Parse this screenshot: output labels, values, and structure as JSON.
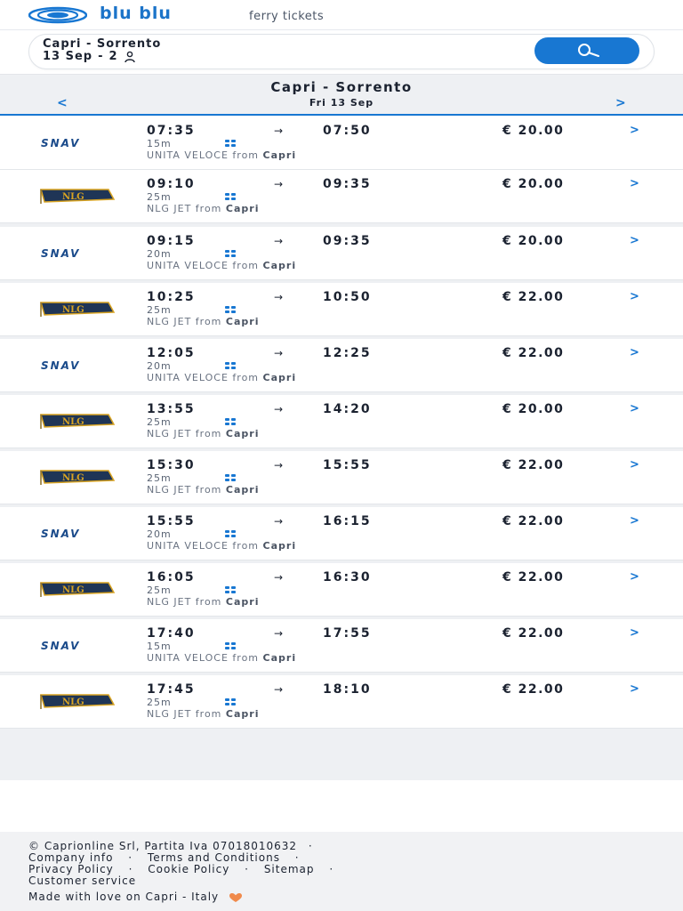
{
  "header": {
    "brand": "blu blu",
    "tagline": "ferry tickets"
  },
  "search": {
    "route": "Capri - Sorrento",
    "date": "13 Sep",
    "separator": "-",
    "passengers": "2"
  },
  "results": {
    "title": "Capri - Sorrento",
    "date": "Fri 13 Sep",
    "prev": "<",
    "next": ">"
  },
  "trips": [
    {
      "operator": "SNAV",
      "dep": "07:35",
      "arr": "07:50",
      "duration": "15m",
      "vessel": "UNITA VELOCE",
      "from_word": "from",
      "port": "Capri",
      "price": "€ 20.00"
    },
    {
      "operator": "NLG",
      "dep": "09:10",
      "arr": "09:35",
      "duration": "25m",
      "vessel": "NLG JET",
      "from_word": "from",
      "port": "Capri",
      "price": "€ 20.00"
    },
    {
      "operator": "SNAV",
      "dep": "09:15",
      "arr": "09:35",
      "duration": "20m",
      "vessel": "UNITA VELOCE",
      "from_word": "from",
      "port": "Capri",
      "price": "€ 20.00"
    },
    {
      "operator": "NLG",
      "dep": "10:25",
      "arr": "10:50",
      "duration": "25m",
      "vessel": "NLG JET",
      "from_word": "from",
      "port": "Capri",
      "price": "€ 22.00"
    },
    {
      "operator": "SNAV",
      "dep": "12:05",
      "arr": "12:25",
      "duration": "20m",
      "vessel": "UNITA VELOCE",
      "from_word": "from",
      "port": "Capri",
      "price": "€ 22.00"
    },
    {
      "operator": "NLG",
      "dep": "13:55",
      "arr": "14:20",
      "duration": "25m",
      "vessel": "NLG JET",
      "from_word": "from",
      "port": "Capri",
      "price": "€ 20.00"
    },
    {
      "operator": "NLG",
      "dep": "15:30",
      "arr": "15:55",
      "duration": "25m",
      "vessel": "NLG JET",
      "from_word": "from",
      "port": "Capri",
      "price": "€ 22.00"
    },
    {
      "operator": "SNAV",
      "dep": "15:55",
      "arr": "16:15",
      "duration": "20m",
      "vessel": "UNITA VELOCE",
      "from_word": "from",
      "port": "Capri",
      "price": "€ 22.00"
    },
    {
      "operator": "NLG",
      "dep": "16:05",
      "arr": "16:30",
      "duration": "25m",
      "vessel": "NLG JET",
      "from_word": "from",
      "port": "Capri",
      "price": "€ 22.00"
    },
    {
      "operator": "SNAV",
      "dep": "17:40",
      "arr": "17:55",
      "duration": "15m",
      "vessel": "UNITA VELOCE",
      "from_word": "from",
      "port": "Capri",
      "price": "€ 22.00"
    },
    {
      "operator": "NLG",
      "dep": "17:45",
      "arr": "18:10",
      "duration": "25m",
      "vessel": "NLG JET",
      "from_word": "from",
      "port": "Capri",
      "price": "€ 22.00"
    }
  ],
  "footer": {
    "copyright": "© Caprionline Srl, Partita Iva 07018010632",
    "links_line1": [
      "Company info",
      "Terms and Conditions"
    ],
    "links_line2": [
      "Privacy Policy",
      "Cookie Policy",
      "Sitemap"
    ],
    "links_line3": [
      "Customer service"
    ],
    "made_with": "Made with love on Capri - Italy",
    "sep": "·"
  },
  "colors": {
    "accent": "#1877d2",
    "text": "#1b2230",
    "band": "#eef0f3",
    "nlg_flag": "#1f3556",
    "nlg_gold": "#d9a422",
    "heart": "#f08a4b"
  }
}
